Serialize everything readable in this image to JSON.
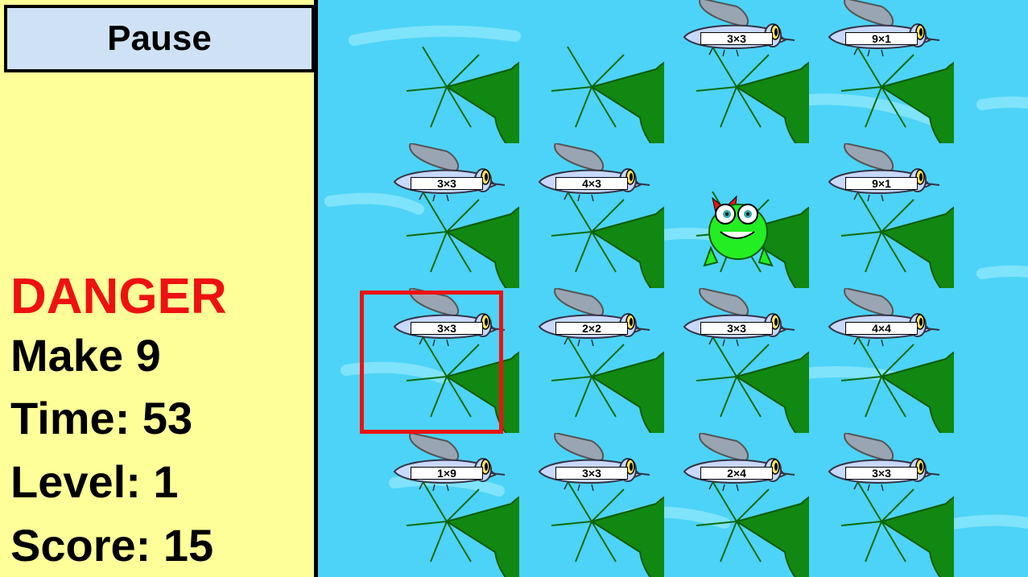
{
  "sidebar": {
    "pause_label": "Pause",
    "danger_label": "DANGER",
    "make_text": "Make 9",
    "time_text": "Time: 53",
    "level_text": "Level: 1",
    "score_text": "Score: 15"
  },
  "colors": {
    "sidebar_bg": "#ffff99",
    "pause_bg": "#cfe2f5",
    "danger": "#ee1111",
    "water": "#4dd3f7",
    "lily_pad": "#118811",
    "fly_body": "#c8d8ff",
    "frog": "#22ee22",
    "selector": "#ee1111"
  },
  "grid": {
    "rows": [
      [
        {
          "fly": null
        },
        {
          "fly": null
        },
        {
          "fly": "3×3"
        },
        {
          "fly": "9×1"
        }
      ],
      [
        {
          "fly": "3×3"
        },
        {
          "fly": "4×3"
        },
        {
          "frog": true
        },
        {
          "fly": "9×1"
        }
      ],
      [
        {
          "fly": "3×3",
          "selected": true
        },
        {
          "fly": "2×2"
        },
        {
          "fly": "3×3"
        },
        {
          "fly": "4×4"
        }
      ],
      [
        {
          "fly": "1×9"
        },
        {
          "fly": "3×3"
        },
        {
          "fly": "2×4"
        },
        {
          "fly": "3×3"
        }
      ]
    ]
  }
}
